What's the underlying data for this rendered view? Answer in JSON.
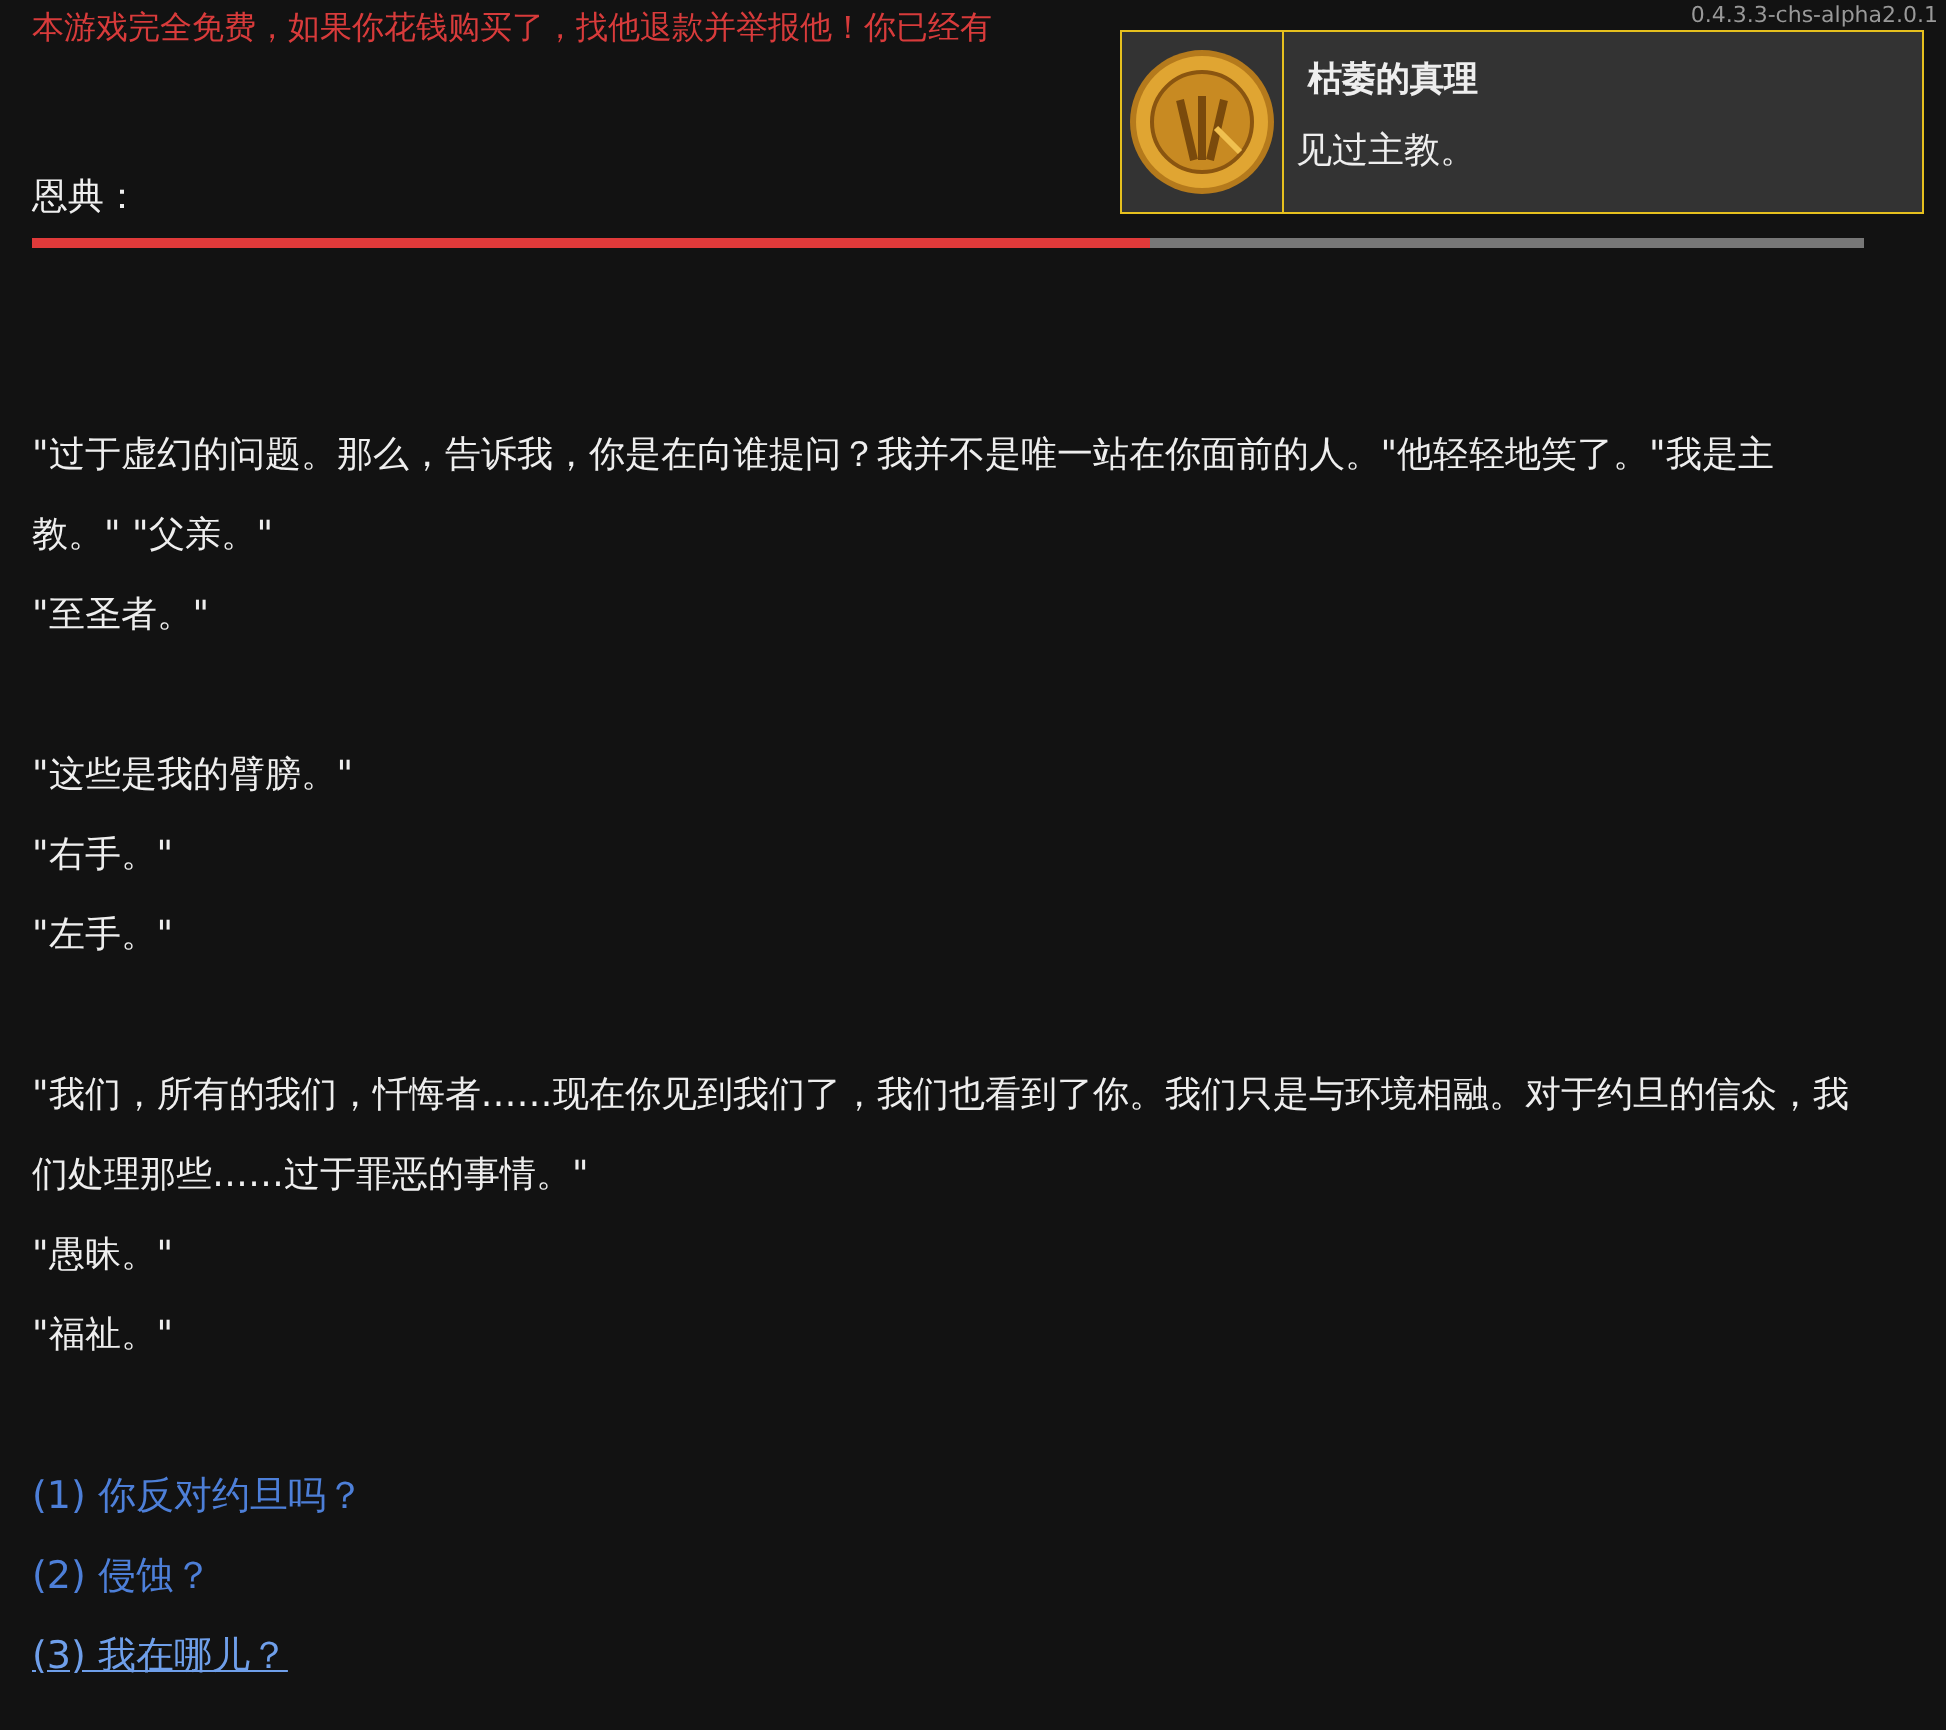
{
  "banner": {
    "notice": "本游戏完全免费，如果你花钱购买了，找他退款并举报他！你已经有",
    "version": "0.4.3.3-chs-alpha2.0.1"
  },
  "achievement": {
    "title": "枯萎的真理",
    "description": "见过主教。"
  },
  "grace": {
    "label": "恩典：",
    "level": 0.61
  },
  "story": [
    [
      "\"过于虚幻的问题。那么，告诉我，你是在向谁提问？我并不是唯一站在你面前的人。\"他轻轻地笑了。\"我是主教。\" \"父亲。\"",
      "\"至圣者。\""
    ],
    [
      "\"这些是我的臂膀。\"",
      "\"右手。\"",
      "\"左手。\""
    ],
    [
      "\"我们，所有的我们，忏悔者……现在你见到我们了，我们也看到了你。我们只是与环境相融。对于约旦的信众，我们处理那些……过于罪恶的事情。\"",
      "\"愚昧。\"",
      "\"福祉。\""
    ]
  ],
  "choices": [
    {
      "label": "(1) 你反对约旦吗？",
      "selected": false
    },
    {
      "label": "(2) 侵蚀？",
      "selected": false
    },
    {
      "label": "(3) 我在哪儿？",
      "selected": true
    }
  ]
}
